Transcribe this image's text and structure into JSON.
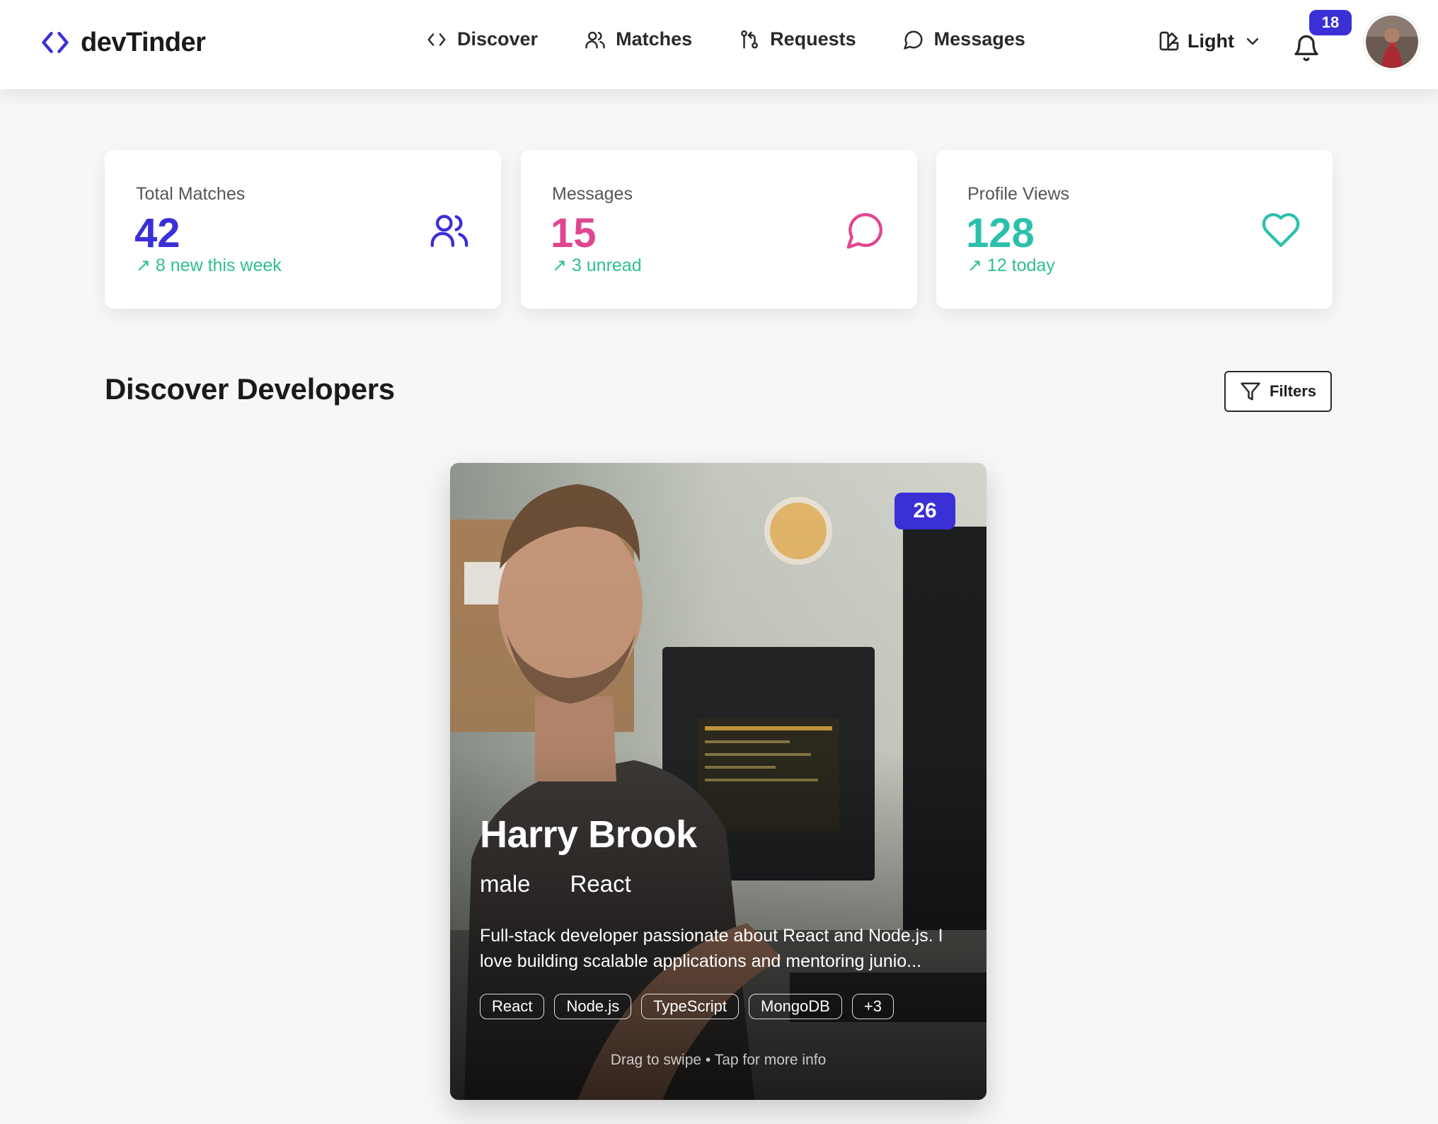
{
  "app": {
    "name": "devTinder"
  },
  "nav": {
    "links": [
      {
        "label": "Discover",
        "icon": "code-icon"
      },
      {
        "label": "Matches",
        "icon": "users-icon"
      },
      {
        "label": "Requests",
        "icon": "git-pull-request-icon"
      },
      {
        "label": "Messages",
        "icon": "chat-bubble-icon"
      }
    ],
    "theme_label": "Light",
    "notification_count": "18"
  },
  "stats": [
    {
      "label": "Total Matches",
      "value": "42",
      "sub": "8 new this week",
      "color": "#3b2fd6",
      "icon": "users-icon"
    },
    {
      "label": "Messages",
      "value": "15",
      "sub": "3 unread",
      "color": "#e0468f",
      "icon": "chat-bubble-icon"
    },
    {
      "label": "Profile Views",
      "value": "128",
      "sub": "12 today",
      "color": "#2cc0ac",
      "icon": "heart-icon"
    }
  ],
  "discover": {
    "title": "Discover Developers",
    "filters_label": "Filters"
  },
  "profile": {
    "age": "26",
    "name": "Harry Brook",
    "gender": "male",
    "primary_skill": "React",
    "bio": "Full-stack developer passionate about React and Node.js. I love building scalable applications and mentoring junio...",
    "skills": [
      "React",
      "Node.js",
      "TypeScript",
      "MongoDB",
      "+3"
    ],
    "hint": "Drag to swipe • Tap for more info"
  },
  "colors": {
    "accent": "#3b2fd6",
    "success": "#2fbf8f",
    "pink": "#e0468f",
    "teal": "#2cc0ac"
  }
}
